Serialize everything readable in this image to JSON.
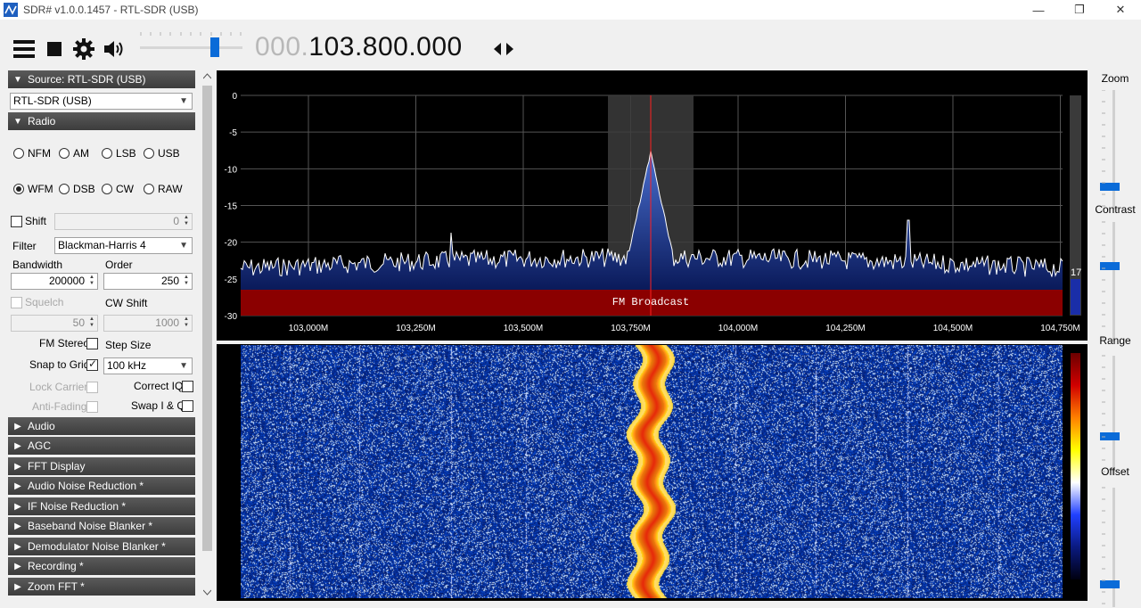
{
  "window": {
    "title": "SDR# v1.0.0.1457 - RTL-SDR (USB)",
    "minimize": "—",
    "restore": "❐",
    "close": "✕"
  },
  "toolbar": {
    "frequency_dim": "000.",
    "frequency_main": "103.800.000",
    "volume_level": 0.75
  },
  "source": {
    "header": "Source: RTL-SDR (USB)",
    "device": "RTL-SDR (USB)"
  },
  "radio": {
    "header": "Radio",
    "modes": [
      "NFM",
      "AM",
      "LSB",
      "USB",
      "WFM",
      "DSB",
      "CW",
      "RAW"
    ],
    "selected_mode": "WFM",
    "shift_label": "Shift",
    "shift_value": "0",
    "filter_label": "Filter",
    "filter_value": "Blackman-Harris 4",
    "bandwidth_label": "Bandwidth",
    "bandwidth_value": "200000",
    "order_label": "Order",
    "order_value": "250",
    "squelch_label": "Squelch",
    "squelch_value": "50",
    "cwshift_label": "CW Shift",
    "cwshift_value": "1000",
    "fmstereo_label": "FM Stereo",
    "stepsize_label": "Step Size",
    "snap_label": "Snap to Grid",
    "step_value": "100 kHz",
    "lockcarrier_label": "Lock Carrier",
    "correctiq_label": "Correct IQ",
    "antifading_label": "Anti-Fading",
    "swapiq_label": "Swap I & Q"
  },
  "sections": [
    "Audio",
    "AGC",
    "FFT Display",
    "Audio Noise Reduction *",
    "IF Noise Reduction *",
    "Baseband Noise Blanker *",
    "Demodulator Noise Blanker *",
    "Recording *",
    "Zoom FFT *"
  ],
  "spectrum": {
    "y_ticks": [
      "0",
      "-5",
      "-10",
      "-15",
      "-20",
      "-25",
      "-30"
    ],
    "x_ticks": [
      "103,000M",
      "103,250M",
      "103,500M",
      "103,750M",
      "104,000M",
      "104,250M",
      "104,500M",
      "104,750M"
    ],
    "band_label": "FM Broadcast",
    "snr_value": "17"
  },
  "right_panel": {
    "zoom": "Zoom",
    "contrast": "Contrast",
    "range": "Range",
    "offset": "Offset"
  },
  "colors": {
    "accent": "#0a6bd8",
    "header_bg": "#3c3c3c",
    "band_red": "#8b0000",
    "tuner_line": "#ff2020"
  }
}
